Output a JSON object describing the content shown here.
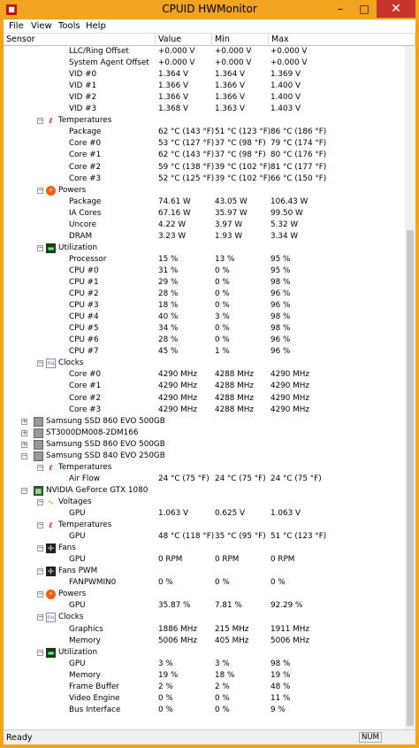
{
  "window": {
    "title": "CPUID HWMonitor",
    "min": "–",
    "max": "□",
    "close": "✕"
  },
  "menu": [
    "File",
    "View",
    "Tools",
    "Help"
  ],
  "columns": [
    "Sensor",
    "Value",
    "Min",
    "Max"
  ],
  "rows": [
    {
      "lvl": 3,
      "n": "LLC/Ring Offset",
      "v": "+0.000 V",
      "mi": "+0.000 V",
      "ma": "+0.000 V"
    },
    {
      "lvl": 3,
      "n": "System Agent Offset",
      "v": "+0.000 V",
      "mi": "+0.000 V",
      "ma": "+0.000 V"
    },
    {
      "lvl": 3,
      "n": "VID #0",
      "v": "1.364 V",
      "mi": "1.364 V",
      "ma": "1.369 V"
    },
    {
      "lvl": 3,
      "n": "VID #1",
      "v": "1.366 V",
      "mi": "1.366 V",
      "ma": "1.400 V"
    },
    {
      "lvl": 3,
      "n": "VID #2",
      "v": "1.366 V",
      "mi": "1.366 V",
      "ma": "1.400 V"
    },
    {
      "lvl": 3,
      "n": "VID #3",
      "v": "1.368 V",
      "mi": "1.363 V",
      "ma": "1.403 V"
    },
    {
      "lvl": 2,
      "n": "Temperatures",
      "icon": "temperature-icon",
      "t": "−"
    },
    {
      "lvl": 3,
      "n": "Package",
      "v": "62 °C  (143 °F)",
      "mi": "51 °C  (123 °F)",
      "ma": "86 °C  (186 °F)"
    },
    {
      "lvl": 3,
      "n": "Core #0",
      "v": "53 °C  (127 °F)",
      "mi": "37 °C  (98 °F)",
      "ma": "79 °C  (174 °F)"
    },
    {
      "lvl": 3,
      "n": "Core #1",
      "v": "62 °C  (143 °F)",
      "mi": "37 °C  (98 °F)",
      "ma": "80 °C  (176 °F)"
    },
    {
      "lvl": 3,
      "n": "Core #2",
      "v": "59 °C  (138 °F)",
      "mi": "39 °C  (102 °F)",
      "ma": "81 °C  (177 °F)"
    },
    {
      "lvl": 3,
      "n": "Core #3",
      "v": "52 °C  (125 °F)",
      "mi": "39 °C  (102 °F)",
      "ma": "66 °C  (150 °F)"
    },
    {
      "lvl": 2,
      "n": "Powers",
      "icon": "power-icon",
      "t": "−"
    },
    {
      "lvl": 3,
      "n": "Package",
      "v": "74.61 W",
      "mi": "43.05 W",
      "ma": "106.43 W"
    },
    {
      "lvl": 3,
      "n": "IA Cores",
      "v": "67.16 W",
      "mi": "35.97 W",
      "ma": "99.50 W"
    },
    {
      "lvl": 3,
      "n": "Uncore",
      "v": "4.22 W",
      "mi": "3.97 W",
      "ma": "5.32 W"
    },
    {
      "lvl": 3,
      "n": "DRAM",
      "v": "3.23 W",
      "mi": "1.93 W",
      "ma": "3.34 W"
    },
    {
      "lvl": 2,
      "n": "Utilization",
      "icon": "utilization-icon",
      "t": "−"
    },
    {
      "lvl": 3,
      "n": "Processor",
      "v": "15 %",
      "mi": "13 %",
      "ma": "95 %"
    },
    {
      "lvl": 3,
      "n": "CPU #0",
      "v": "31 %",
      "mi": "0 %",
      "ma": "95 %"
    },
    {
      "lvl": 3,
      "n": "CPU #1",
      "v": "29 %",
      "mi": "0 %",
      "ma": "98 %"
    },
    {
      "lvl": 3,
      "n": "CPU #2",
      "v": "28 %",
      "mi": "0 %",
      "ma": "96 %"
    },
    {
      "lvl": 3,
      "n": "CPU #3",
      "v": "18 %",
      "mi": "0 %",
      "ma": "96 %"
    },
    {
      "lvl": 3,
      "n": "CPU #4",
      "v": "40 %",
      "mi": "3 %",
      "ma": "98 %"
    },
    {
      "lvl": 3,
      "n": "CPU #5",
      "v": "34 %",
      "mi": "0 %",
      "ma": "98 %"
    },
    {
      "lvl": 3,
      "n": "CPU #6",
      "v": "28 %",
      "mi": "0 %",
      "ma": "96 %"
    },
    {
      "lvl": 3,
      "n": "CPU #7",
      "v": "45 %",
      "mi": "1 %",
      "ma": "96 %"
    },
    {
      "lvl": 2,
      "n": "Clocks",
      "icon": "clock-icon",
      "t": "−"
    },
    {
      "lvl": 3,
      "n": "Core #0",
      "v": "4290 MHz",
      "mi": "4288 MHz",
      "ma": "4290 MHz"
    },
    {
      "lvl": 3,
      "n": "Core #1",
      "v": "4290 MHz",
      "mi": "4288 MHz",
      "ma": "4290 MHz"
    },
    {
      "lvl": 3,
      "n": "Core #2",
      "v": "4290 MHz",
      "mi": "4288 MHz",
      "ma": "4290 MHz"
    },
    {
      "lvl": 3,
      "n": "Core #3",
      "v": "4290 MHz",
      "mi": "4288 MHz",
      "ma": "4290 MHz"
    },
    {
      "lvl": 1,
      "n": "Samsung SSD 860 EVO 500GB",
      "icon": "disk-icon",
      "t": "+"
    },
    {
      "lvl": 1,
      "n": "ST3000DM008-2DM166",
      "icon": "disk-icon",
      "t": "+"
    },
    {
      "lvl": 1,
      "n": "Samsung SSD 860 EVO 500GB",
      "icon": "disk-icon",
      "t": "+"
    },
    {
      "lvl": 1,
      "n": "Samsung SSD 840 EVO 250GB",
      "icon": "disk-icon",
      "t": "−"
    },
    {
      "lvl": 2,
      "n": "Temperatures",
      "icon": "temperature-icon",
      "t": "−"
    },
    {
      "lvl": 3,
      "n": "Air Flow",
      "v": "24 °C  (75 °F)",
      "mi": "24 °C  (75 °F)",
      "ma": "24 °C  (75 °F)"
    },
    {
      "lvl": 1,
      "n": "NVIDIA GeForce GTX 1080",
      "icon": "gpu-icon",
      "t": "−"
    },
    {
      "lvl": 2,
      "n": "Voltages",
      "icon": "voltage-icon",
      "t": "−"
    },
    {
      "lvl": 3,
      "n": "GPU",
      "v": "1.063 V",
      "mi": "0.625 V",
      "ma": "1.063 V"
    },
    {
      "lvl": 2,
      "n": "Temperatures",
      "icon": "temperature-icon",
      "t": "−"
    },
    {
      "lvl": 3,
      "n": "GPU",
      "v": "48 °C  (118 °F)",
      "mi": "35 °C  (95 °F)",
      "ma": "51 °C  (123 °F)"
    },
    {
      "lvl": 2,
      "n": "Fans",
      "icon": "fan-icon",
      "t": "−"
    },
    {
      "lvl": 3,
      "n": "GPU",
      "v": "0 RPM",
      "mi": "0 RPM",
      "ma": "0 RPM"
    },
    {
      "lvl": 2,
      "n": "Fans PWM",
      "icon": "fan-pwm-icon",
      "t": "−"
    },
    {
      "lvl": 3,
      "n": "FANPWMIN0",
      "v": "0 %",
      "mi": "0 %",
      "ma": "0 %"
    },
    {
      "lvl": 2,
      "n": "Powers",
      "icon": "power-icon",
      "t": "−"
    },
    {
      "lvl": 3,
      "n": "GPU",
      "v": "35.87 %",
      "mi": "7.81 %",
      "ma": "92.29 %"
    },
    {
      "lvl": 2,
      "n": "Clocks",
      "icon": "clock-icon",
      "t": "−"
    },
    {
      "lvl": 3,
      "n": "Graphics",
      "v": "1886 MHz",
      "mi": "215 MHz",
      "ma": "1911 MHz"
    },
    {
      "lvl": 3,
      "n": "Memory",
      "v": "5006 MHz",
      "mi": "405 MHz",
      "ma": "5006 MHz"
    },
    {
      "lvl": 2,
      "n": "Utilization",
      "icon": "utilization-icon",
      "t": "−"
    },
    {
      "lvl": 3,
      "n": "GPU",
      "v": "3 %",
      "mi": "3 %",
      "ma": "98 %"
    },
    {
      "lvl": 3,
      "n": "Memory",
      "v": "19 %",
      "mi": "18 %",
      "ma": "19 %"
    },
    {
      "lvl": 3,
      "n": "Frame Buffer",
      "v": "2 %",
      "mi": "2 %",
      "ma": "48 %"
    },
    {
      "lvl": 3,
      "n": "Video Engine",
      "v": "0 %",
      "mi": "0 %",
      "ma": "11 %"
    },
    {
      "lvl": 3,
      "n": "Bus Interface",
      "v": "0 %",
      "mi": "0 %",
      "ma": "9 %"
    }
  ],
  "status": {
    "text": "Ready",
    "num": "NUM"
  }
}
